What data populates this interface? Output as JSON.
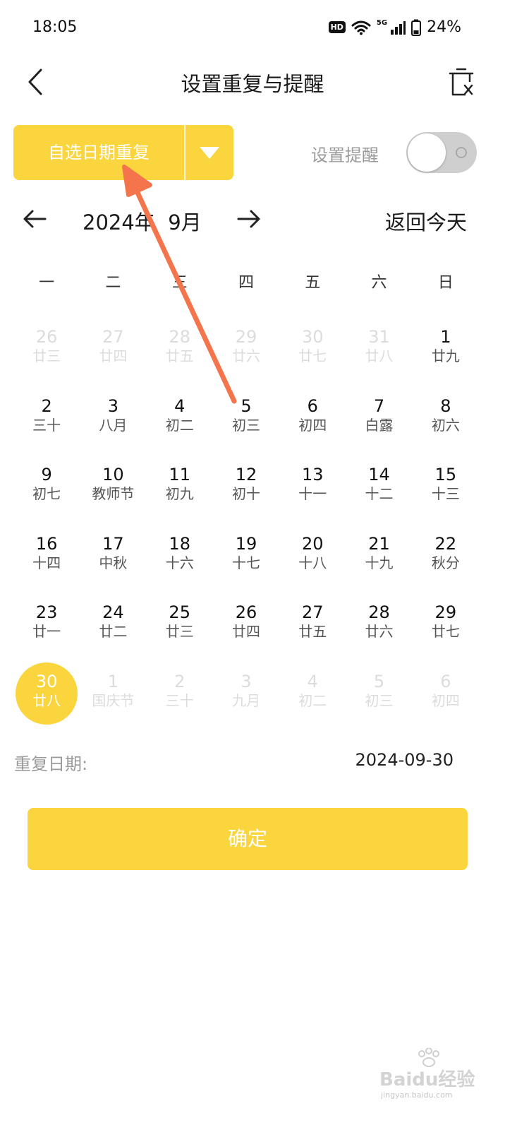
{
  "status_bar": {
    "time": "18:05",
    "hd": "HD",
    "network": "5G",
    "battery": "24%"
  },
  "header": {
    "title": "设置重复与提醒"
  },
  "mode_select": {
    "label": "自选日期重复"
  },
  "reminder": {
    "label": "设置提醒",
    "enabled": false
  },
  "month_nav": {
    "label": "2024年  9月",
    "today": "返回今天"
  },
  "weekdays": [
    "一",
    "二",
    "三",
    "四",
    "五",
    "六",
    "日"
  ],
  "weeks": [
    [
      {
        "n": "26",
        "l": "廿三",
        "other": true
      },
      {
        "n": "27",
        "l": "廿四",
        "other": true
      },
      {
        "n": "28",
        "l": "廿五",
        "other": true
      },
      {
        "n": "29",
        "l": "廿六",
        "other": true
      },
      {
        "n": "30",
        "l": "廿七",
        "other": true
      },
      {
        "n": "31",
        "l": "廿八",
        "other": true
      },
      {
        "n": "1",
        "l": "廿九"
      }
    ],
    [
      {
        "n": "2",
        "l": "三十"
      },
      {
        "n": "3",
        "l": "八月"
      },
      {
        "n": "4",
        "l": "初二"
      },
      {
        "n": "5",
        "l": "初三"
      },
      {
        "n": "6",
        "l": "初四"
      },
      {
        "n": "7",
        "l": "白露"
      },
      {
        "n": "8",
        "l": "初六"
      }
    ],
    [
      {
        "n": "9",
        "l": "初七"
      },
      {
        "n": "10",
        "l": "教师节"
      },
      {
        "n": "11",
        "l": "初九"
      },
      {
        "n": "12",
        "l": "初十"
      },
      {
        "n": "13",
        "l": "十一"
      },
      {
        "n": "14",
        "l": "十二"
      },
      {
        "n": "15",
        "l": "十三"
      }
    ],
    [
      {
        "n": "16",
        "l": "十四"
      },
      {
        "n": "17",
        "l": "中秋"
      },
      {
        "n": "18",
        "l": "十六"
      },
      {
        "n": "19",
        "l": "十七"
      },
      {
        "n": "20",
        "l": "十八"
      },
      {
        "n": "21",
        "l": "十九"
      },
      {
        "n": "22",
        "l": "秋分"
      }
    ],
    [
      {
        "n": "23",
        "l": "廿一"
      },
      {
        "n": "24",
        "l": "廿二"
      },
      {
        "n": "25",
        "l": "廿三"
      },
      {
        "n": "26",
        "l": "廿四"
      },
      {
        "n": "27",
        "l": "廿五"
      },
      {
        "n": "28",
        "l": "廿六"
      },
      {
        "n": "29",
        "l": "廿七"
      }
    ],
    [
      {
        "n": "30",
        "l": "廿八",
        "selected": true
      },
      {
        "n": "1",
        "l": "国庆节",
        "other": true
      },
      {
        "n": "2",
        "l": "三十",
        "other": true
      },
      {
        "n": "3",
        "l": "九月",
        "other": true
      },
      {
        "n": "4",
        "l": "初二",
        "other": true
      },
      {
        "n": "5",
        "l": "初三",
        "other": true
      },
      {
        "n": "6",
        "l": "初四",
        "other": true
      }
    ]
  ],
  "repeat": {
    "label": "重复日期:",
    "value": "2024-09-30"
  },
  "confirm": {
    "label": "确定"
  },
  "icons": {
    "back": "chevron-left-icon",
    "trash": "trash-icon",
    "dropdown": "triangle-down-icon",
    "prev": "arrow-left-icon",
    "next": "arrow-right-icon"
  },
  "colors": {
    "accent": "#fbd53e",
    "annotation": "#f4744b"
  },
  "watermark": {
    "brand": "Baidu经验",
    "url": "jingyan.baidu.com"
  }
}
